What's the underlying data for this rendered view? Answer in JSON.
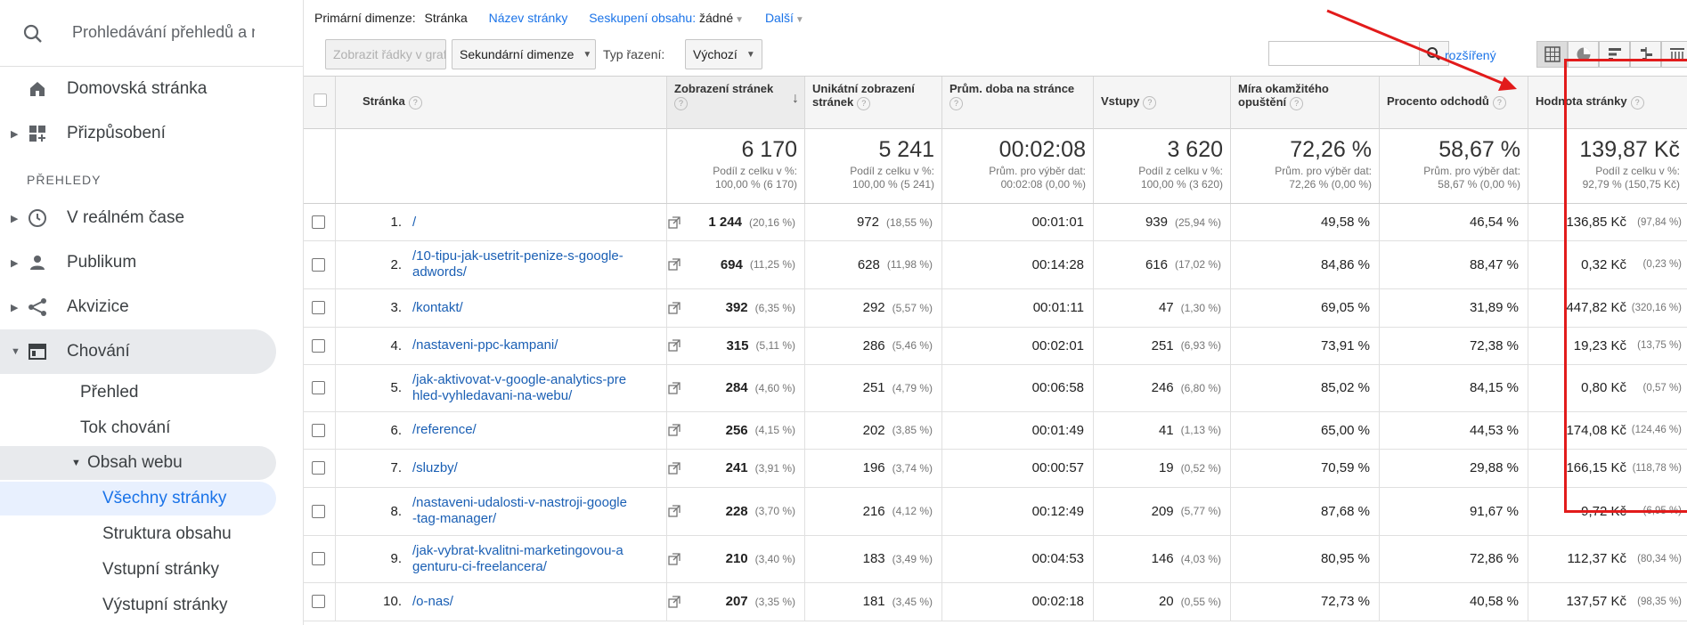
{
  "sidebar": {
    "search_placeholder": "Prohledávání přehledů a náp",
    "items": [
      {
        "label": "Domovská stránka"
      },
      {
        "label": "Přizpůsobení"
      }
    ],
    "section_label": "PŘEHLEDY",
    "reports": [
      {
        "label": "V reálném čase"
      },
      {
        "label": "Publikum"
      },
      {
        "label": "Akvizice"
      },
      {
        "label": "Chování"
      }
    ],
    "behaviour_sub": [
      {
        "label": "Přehled"
      },
      {
        "label": "Tok chování"
      },
      {
        "label": "Obsah webu"
      },
      {
        "label": "Všechny stránky"
      },
      {
        "label": "Struktura obsahu"
      },
      {
        "label": "Vstupní stránky"
      },
      {
        "label": "Výstupní stránky"
      }
    ]
  },
  "dimensions": {
    "primary_label": "Primární dimenze:",
    "primary_value": "Stránka",
    "alt_1": "Název stránky",
    "grouping_label": "Seskupení obsahu:",
    "grouping_value": "žádné",
    "more": "Další"
  },
  "toolbar": {
    "plot_rows": "Zobrazit řádky v grafu",
    "secondary_dim": "Sekundární dimenze",
    "sort_label": "Typ řazení:",
    "sort_value": "Výchozí",
    "advanced": "rozšířený"
  },
  "table": {
    "headers": {
      "page": "Stránka",
      "pageviews": "Zobrazení stránek",
      "unique_l1": "Unikátní zobrazení",
      "unique_l2": "stránek",
      "avg_time": "Prům. doba na stránce",
      "entrances": "Vstupy",
      "bounce_l1": "Míra okamžitého",
      "bounce_l2": "opuštění",
      "exit": "Procento odchodů",
      "value": "Hodnota stránky"
    },
    "totals": {
      "pageviews": {
        "big": "6 170",
        "l1": "Podíl z celku v %:",
        "l2": "100,00 % (6 170)"
      },
      "unique": {
        "big": "5 241",
        "l1": "Podíl z celku v %:",
        "l2": "100,00 % (5 241)"
      },
      "avg_time": {
        "big": "00:02:08",
        "l1": "Prům. pro výběr dat:",
        "l2": "00:02:08 (0,00 %)"
      },
      "entrances": {
        "big": "3 620",
        "l1": "Podíl z celku v %:",
        "l2": "100,00 % (3 620)"
      },
      "bounce": {
        "big": "72,26 %",
        "l1": "Prům. pro výběr dat:",
        "l2": "72,26 % (0,00 %)"
      },
      "exit": {
        "big": "58,67 %",
        "l1": "Prům. pro výběr dat:",
        "l2": "58,67 % (0,00 %)"
      },
      "value": {
        "big": "139,87 Kč",
        "l1": "Podíl z celku v %:",
        "l2": "92,79 % (150,75 Kč)"
      }
    },
    "rows": [
      {
        "idx": "1.",
        "page": "/",
        "pv": "1 244",
        "pv_pct": "(20,16 %)",
        "uv": "972",
        "uv_pct": "(18,55 %)",
        "time": "00:01:01",
        "ent": "939",
        "ent_pct": "(25,94 %)",
        "bounce": "49,58 %",
        "exit": "46,54 %",
        "val": "136,85 Kč",
        "val_pct": "(97,84 %)"
      },
      {
        "idx": "2.",
        "page": "/10-tipu-jak-usetrit-penize-s-google-adwords/",
        "pv": "694",
        "pv_pct": "(11,25 %)",
        "uv": "628",
        "uv_pct": "(11,98 %)",
        "time": "00:14:28",
        "ent": "616",
        "ent_pct": "(17,02 %)",
        "bounce": "84,86 %",
        "exit": "88,47 %",
        "val": "0,32 Kč",
        "val_pct": "(0,23 %)"
      },
      {
        "idx": "3.",
        "page": "/kontakt/",
        "pv": "392",
        "pv_pct": "(6,35 %)",
        "uv": "292",
        "uv_pct": "(5,57 %)",
        "time": "00:01:11",
        "ent": "47",
        "ent_pct": "(1,30 %)",
        "bounce": "69,05 %",
        "exit": "31,89 %",
        "val": "447,82 Kč",
        "val_pct": "(320,16 %)"
      },
      {
        "idx": "4.",
        "page": "/nastaveni-ppc-kampani/",
        "pv": "315",
        "pv_pct": "(5,11 %)",
        "uv": "286",
        "uv_pct": "(5,46 %)",
        "time": "00:02:01",
        "ent": "251",
        "ent_pct": "(6,93 %)",
        "bounce": "73,91 %",
        "exit": "72,38 %",
        "val": "19,23 Kč",
        "val_pct": "(13,75 %)"
      },
      {
        "idx": "5.",
        "page": "/jak-aktivovat-v-google-analytics-prehled-vyhledavani-na-webu/",
        "pv": "284",
        "pv_pct": "(4,60 %)",
        "uv": "251",
        "uv_pct": "(4,79 %)",
        "time": "00:06:58",
        "ent": "246",
        "ent_pct": "(6,80 %)",
        "bounce": "85,02 %",
        "exit": "84,15 %",
        "val": "0,80 Kč",
        "val_pct": "(0,57 %)"
      },
      {
        "idx": "6.",
        "page": "/reference/",
        "pv": "256",
        "pv_pct": "(4,15 %)",
        "uv": "202",
        "uv_pct": "(3,85 %)",
        "time": "00:01:49",
        "ent": "41",
        "ent_pct": "(1,13 %)",
        "bounce": "65,00 %",
        "exit": "44,53 %",
        "val": "174,08 Kč",
        "val_pct": "(124,46 %)"
      },
      {
        "idx": "7.",
        "page": "/sluzby/",
        "pv": "241",
        "pv_pct": "(3,91 %)",
        "uv": "196",
        "uv_pct": "(3,74 %)",
        "time": "00:00:57",
        "ent": "19",
        "ent_pct": "(0,52 %)",
        "bounce": "70,59 %",
        "exit": "29,88 %",
        "val": "166,15 Kč",
        "val_pct": "(118,78 %)"
      },
      {
        "idx": "8.",
        "page": "/nastaveni-udalosti-v-nastroji-google-tag-manager/",
        "pv": "228",
        "pv_pct": "(3,70 %)",
        "uv": "216",
        "uv_pct": "(4,12 %)",
        "time": "00:12:49",
        "ent": "209",
        "ent_pct": "(5,77 %)",
        "bounce": "87,68 %",
        "exit": "91,67 %",
        "val": "9,72 Kč",
        "val_pct": "(6,95 %)"
      },
      {
        "idx": "9.",
        "page": "/jak-vybrat-kvalitni-marketingovou-agenturu-ci-freelancera/",
        "pv": "210",
        "pv_pct": "(3,40 %)",
        "uv": "183",
        "uv_pct": "(3,49 %)",
        "time": "00:04:53",
        "ent": "146",
        "ent_pct": "(4,03 %)",
        "bounce": "80,95 %",
        "exit": "72,86 %",
        "val": "112,37 Kč",
        "val_pct": "(80,34 %)"
      },
      {
        "idx": "10.",
        "page": "/o-nas/",
        "pv": "207",
        "pv_pct": "(3,35 %)",
        "uv": "181",
        "uv_pct": "(3,45 %)",
        "time": "00:02:18",
        "ent": "20",
        "ent_pct": "(0,55 %)",
        "bounce": "72,73 %",
        "exit": "40,58 %",
        "val": "137,57 Kč",
        "val_pct": "(98,35 %)"
      }
    ]
  },
  "colors": {
    "link": "#1a73e8",
    "highlight": "#e21b1b",
    "selected_bg": "#e8f0fe"
  }
}
